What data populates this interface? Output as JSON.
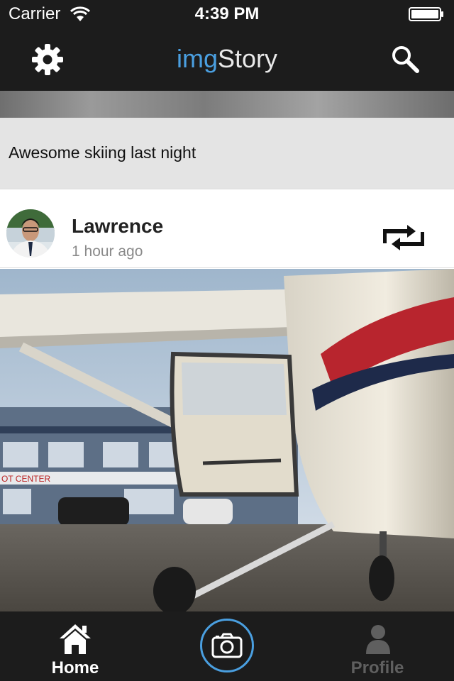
{
  "status_bar": {
    "carrier": "Carrier",
    "time": "4:39 PM"
  },
  "header": {
    "title_part1": "img",
    "title_part2": "Story",
    "title_part1_color": "#4a9fe0",
    "icons": {
      "left": "gear-icon",
      "right": "search-icon"
    }
  },
  "previous_post": {
    "caption": "Awesome skiing last night"
  },
  "post": {
    "username": "Lawrence",
    "time_ago": "1 hour ago",
    "action_icon": "repost-icon"
  },
  "tab_bar": {
    "home_label": "Home",
    "profile_label": "Profile",
    "accent_color": "#4a9fe0",
    "active_tab": "Home"
  }
}
